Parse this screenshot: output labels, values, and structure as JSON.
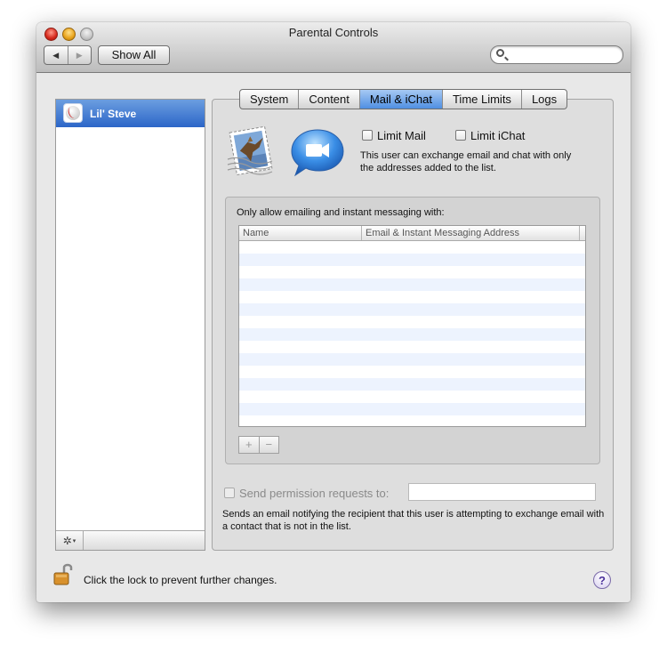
{
  "window": {
    "title": "Parental Controls"
  },
  "toolbar": {
    "back_glyph": "◀",
    "forward_glyph": "▶",
    "show_all_label": "Show All",
    "search_value": ""
  },
  "sidebar": {
    "selected_user": {
      "name": "Lil' Steve",
      "icon": "baseball-avatar-icon"
    },
    "footer_action_icon": "gear-icon",
    "footer_action_glyph": "✲",
    "footer_caret_glyph": "▾"
  },
  "tabs": [
    {
      "label": "System",
      "active": false
    },
    {
      "label": "Content",
      "active": false
    },
    {
      "label": "Mail & iChat",
      "active": true
    },
    {
      "label": "Time Limits",
      "active": false
    },
    {
      "label": "Logs",
      "active": false
    }
  ],
  "mail_ichat": {
    "icons": [
      "mail-stamp-icon",
      "ichat-icon"
    ],
    "limit_mail_label": "Limit Mail",
    "limit_mail_checked": false,
    "limit_ichat_label": "Limit iChat",
    "limit_ichat_checked": false,
    "description": "This user can exchange email and chat with only the addresses added to the list.",
    "allow_label": "Only allow emailing and instant messaging with:",
    "table": {
      "columns": [
        "Name",
        "Email & Instant Messaging Address"
      ],
      "rows": []
    },
    "add_glyph": "+",
    "remove_glyph": "−",
    "permission_label": "Send permission requests to:",
    "permission_checked": false,
    "permission_value": "",
    "permission_description": "Sends an email notifying the recipient that this user is attempting to exchange email with a contact that is not in the list."
  },
  "footer": {
    "lock_text": "Click the lock to prevent further changes.",
    "lock_icon": "unlocked-padlock-icon",
    "help_glyph": "?"
  },
  "colors": {
    "selection_blue": "#3a74d0",
    "active_tab": "#6fa3ea",
    "close_button": "#d5281b",
    "minimize_button": "#e8a21a",
    "stripe": "#edf3fe"
  }
}
